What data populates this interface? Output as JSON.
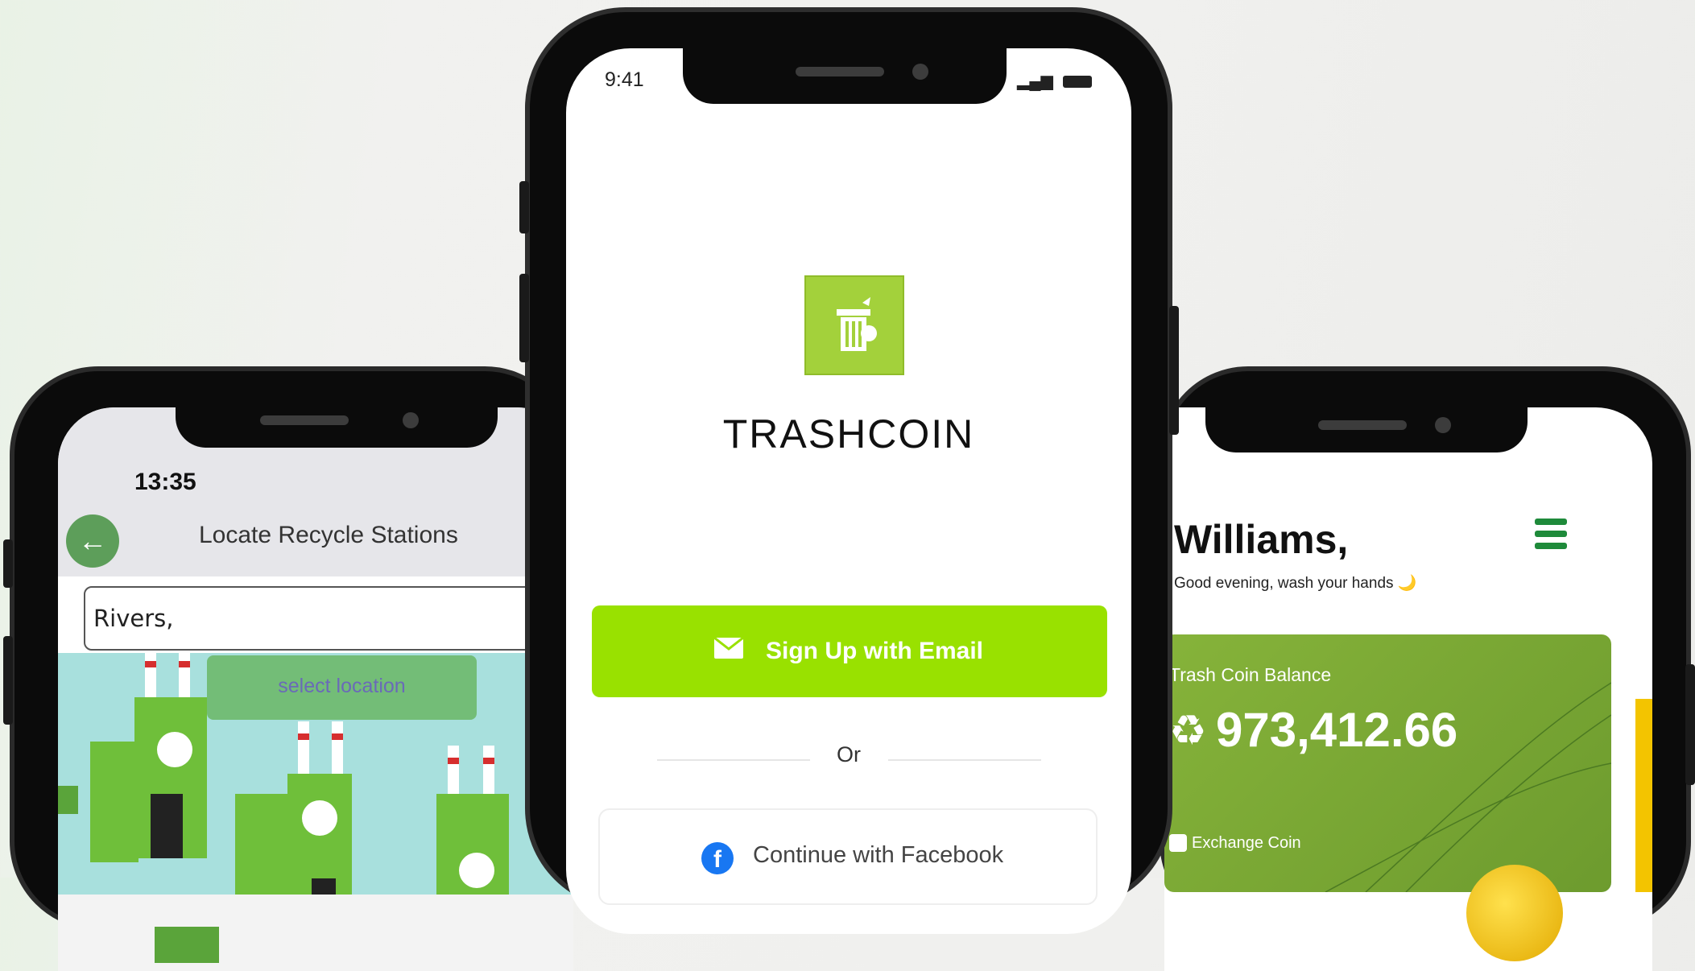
{
  "left_screen": {
    "status_time": "13:35",
    "title": "Locate Recycle Stations",
    "search_value": "Rivers,",
    "select_location": "select location",
    "icons": {
      "back": "arrow-left-icon"
    }
  },
  "center_screen": {
    "status_time": "9:41",
    "brand": "TRASHCOIN",
    "email_button": "Sign Up with Email",
    "or_text": "Or",
    "facebook_button": "Continue with Facebook",
    "icons": {
      "logo": "trash-bin-icon",
      "email": "mail-icon",
      "facebook": "facebook-icon"
    },
    "colors": {
      "primary": "#99e100",
      "logo_bg": "#a3d13b"
    }
  },
  "right_screen": {
    "greeting_name": "Williams,",
    "greeting_sub": "Good evening, wash your hands 🌙",
    "balance_label": "Trash Coin Balance",
    "balance_value": "973,412.66",
    "exchange_label": "Exchange Coin",
    "icons": {
      "menu": "hamburger-menu-icon",
      "recycle": "recycle-icon"
    },
    "colors": {
      "card": "#7aa535",
      "menu": "#1e8a3a"
    }
  }
}
